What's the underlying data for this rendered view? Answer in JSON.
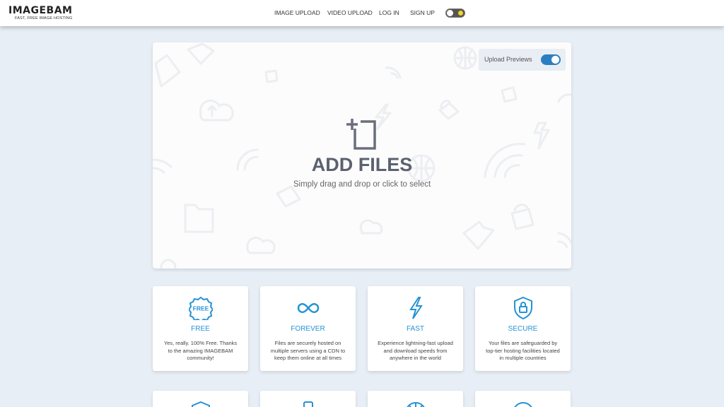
{
  "header": {
    "logo_title": "IMAGEBAM",
    "logo_subtitle": "FAST, FREE IMAGE HOSTING",
    "nav": [
      "IMAGE UPLOAD",
      "VIDEO UPLOAD",
      "LOG IN",
      "SIGN UP"
    ],
    "theme_toggle_state": "light"
  },
  "upload": {
    "previews_label": "Upload Previews",
    "previews_enabled": true,
    "title": "ADD FILES",
    "subtitle": "Simply drag and drop or click to select"
  },
  "features": [
    {
      "icon": "free-badge-icon",
      "title": "FREE",
      "desc": "Yes, really. 100% Free. Thanks to the amazing IMAGEBAM community!"
    },
    {
      "icon": "infinity-icon",
      "title": "FOREVER",
      "desc": "Files are securely hosted on multiple servers using a CDN to keep them online at all times"
    },
    {
      "icon": "lightning-icon",
      "title": "FAST",
      "desc": "Experience lightning-fast upload and download speeds from anywhere in the world"
    },
    {
      "icon": "shield-lock-icon",
      "title": "SECURE",
      "desc": "Your files are safeguarded by top-tier hosting facilities located in multiple countries"
    }
  ],
  "colors": {
    "accent": "#2592d4",
    "toggle_on": "#2a7fc3",
    "page_bg": "#e8eef5",
    "title_gray": "#5b6170"
  }
}
